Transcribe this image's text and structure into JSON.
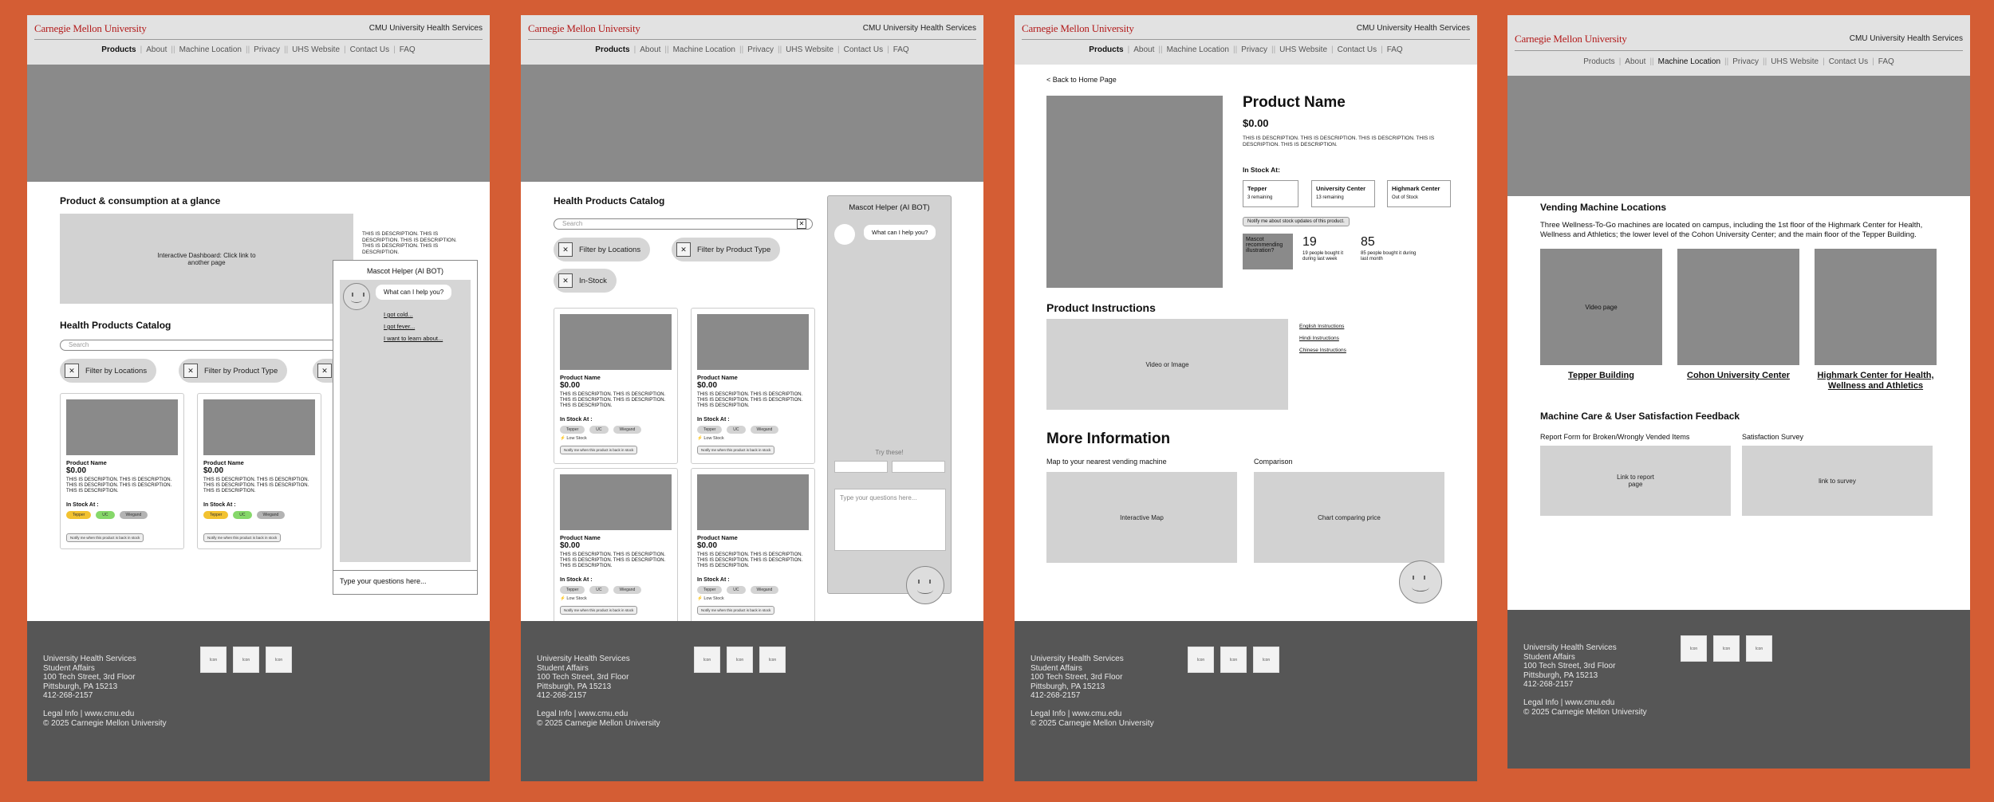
{
  "header": {
    "logo": "Carnegie Mellon University",
    "site_name": "CMU University Health Services",
    "nav": [
      "Products",
      "About",
      "Machine Location",
      "Privacy",
      "UHS Website",
      "Contact Us",
      "FAQ"
    ]
  },
  "footer": {
    "address": [
      "University Health Services",
      "Student Affairs",
      "100 Tech Street, 3rd Floor",
      "Pittsburgh, PA 15213",
      "412-268-2157"
    ],
    "legal": "Legal Info | www.cmu.edu",
    "copyright": "© 2025 Carnegie Mellon University",
    "social_icon_label": "Icon"
  },
  "common": {
    "description": "THIS IS DESCRIPTION. THIS IS DESCRIPTION. THIS IS DESCRIPTION. THIS IS DESCRIPTION. THIS IS DESCRIPTION.",
    "product_name": "Product Name",
    "price": "$0.00",
    "in_stock": "In Stock At :",
    "tags": [
      "Tepper",
      "UC",
      "Wiegand"
    ],
    "low_stock": "⚡ Low Stock",
    "notify": "Notify me when this product is back in stock",
    "search_placeholder": "Search",
    "filters": [
      "Filter by Locations",
      "Filter by Product Type",
      "In-Stock"
    ]
  },
  "page1": {
    "glance_title": "Product & consumption at a glance",
    "dashboard": "Interactive Dashboard: Click link to another page",
    "catalog_title": "Health Products Catalog",
    "bot_title": "Mascot Helper (AI BOT)",
    "bot_greeting": "What can I help you?",
    "bot_options": [
      "I got cold...",
      "I got fever...",
      "I want to learn about..."
    ],
    "bot_input": "Type your questions here..."
  },
  "page2": {
    "catalog_title": "Health Products Catalog",
    "bot_title": "Mascot Helper (AI BOT)",
    "bot_greeting": "What can I help you?",
    "try_these": "Try these!",
    "bot_input": "Type your questions here..."
  },
  "page3": {
    "back": "< Back to Home Page",
    "product_name": "Product Name",
    "price": "$0.00",
    "in_stock": "In Stock At:",
    "locations": [
      {
        "name": "Tepper",
        "status": "3 remaining"
      },
      {
        "name": "University Center",
        "status": "13 remaining"
      },
      {
        "name": "Highmark Center",
        "status": "Out of Stock"
      }
    ],
    "notify": "Notify me about stock updates of this product.",
    "mascot": "Mascot recommending illustration?",
    "stat1_value": "19",
    "stat1_label": "19 people bought it during last week",
    "stat2_value": "85",
    "stat2_label": "85 people bought it during last month",
    "instructions_title": "Product Instructions",
    "video": "Video or Image",
    "languages": [
      "English Instructions",
      "Hindi Instructions",
      "Chinese Instructions"
    ],
    "more_title": "More Information",
    "map_label": "Map to your nearest vending machine",
    "map_box": "Interactive Map",
    "comparison_label": "Comparison",
    "comparison_box": "Chart comparing price"
  },
  "page4": {
    "title": "Vending Machine Locations",
    "intro": "Three Wellness-To-Go machines are located on campus, including the 1st floor of the Highmark Center for Health, Wellness and Athletics; the lower level of the Cohon University Center; and the main floor of the Tepper Building.",
    "video_label": "Video page",
    "locations": [
      "Tepper Building",
      "Cohon University Center",
      "Highmark Center for Health, Wellness and Athletics"
    ],
    "care_title": "Machine Care & User Satisfaction Feedback",
    "report_label": "Report Form for Broken/Wrongly Vended Items",
    "report_box": "Link to report page",
    "survey_label": "Satisfaction Survey",
    "survey_box": "link to survey"
  }
}
